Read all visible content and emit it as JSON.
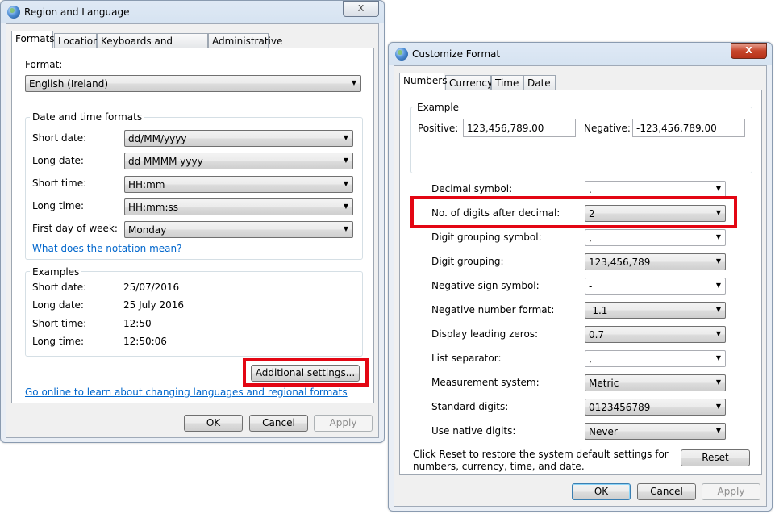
{
  "region_dialog": {
    "title": "Region and Language",
    "close_label": "X",
    "tabs": [
      "Formats",
      "Location",
      "Keyboards and Languages",
      "Administrative"
    ],
    "format_label": "Format:",
    "format_value": "English (Ireland)",
    "datetime_group": "Date and time formats",
    "short_date_label": "Short date:",
    "short_date_value": "dd/MM/yyyy",
    "long_date_label": "Long date:",
    "long_date_value": "dd MMMM yyyy",
    "short_time_label": "Short time:",
    "short_time_value": "HH:mm",
    "long_time_label": "Long time:",
    "long_time_value": "HH:mm:ss",
    "first_day_label": "First day of week:",
    "first_day_value": "Monday",
    "notation_link": "What does the notation mean?",
    "examples_group": "Examples",
    "ex_short_date_label": "Short date:",
    "ex_short_date_value": "25/07/2016",
    "ex_long_date_label": "Long date:",
    "ex_long_date_value": "25 July 2016",
    "ex_short_time_label": "Short time:",
    "ex_short_time_value": "12:50",
    "ex_long_time_label": "Long time:",
    "ex_long_time_value": "12:50:06",
    "additional_settings": "Additional settings...",
    "online_link": "Go online to learn about changing languages and regional formats",
    "ok": "OK",
    "cancel": "Cancel",
    "apply": "Apply"
  },
  "customize_dialog": {
    "title": "Customize Format",
    "close_label": "X",
    "tabs": [
      "Numbers",
      "Currency",
      "Time",
      "Date"
    ],
    "example_group": "Example",
    "positive_label": "Positive:",
    "positive_value": "123,456,789.00",
    "negative_label": "Negative:",
    "negative_value": "-123,456,789.00",
    "settings": [
      {
        "label": "Decimal symbol:",
        "value": "."
      },
      {
        "label": "No. of digits after decimal:",
        "value": "2"
      },
      {
        "label": "Digit grouping symbol:",
        "value": ","
      },
      {
        "label": "Digit grouping:",
        "value": "123,456,789"
      },
      {
        "label": "Negative sign symbol:",
        "value": "-"
      },
      {
        "label": "Negative number format:",
        "value": "-1.1"
      },
      {
        "label": "Display leading zeros:",
        "value": "0.7"
      },
      {
        "label": "List separator:",
        "value": ","
      },
      {
        "label": "Measurement system:",
        "value": "Metric"
      },
      {
        "label": "Standard digits:",
        "value": "0123456789"
      },
      {
        "label": "Use native digits:",
        "value": "Never"
      }
    ],
    "reset_note_line1": "Click Reset to restore the system default settings for",
    "reset_note_line2": "numbers, currency, time, and date.",
    "reset": "Reset",
    "ok": "OK",
    "cancel": "Cancel",
    "apply": "Apply"
  },
  "colors": {
    "highlight": "#e30613",
    "link": "#0066cc"
  }
}
